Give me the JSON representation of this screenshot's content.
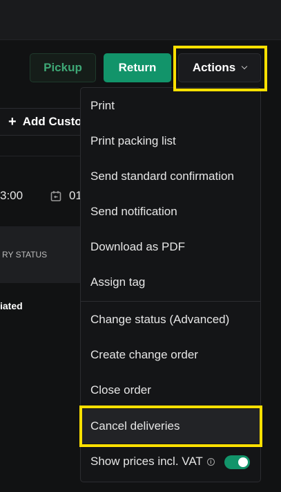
{
  "header": {
    "pickup_label": "Pickup",
    "return_label": "Return",
    "actions_label": "Actions"
  },
  "background": {
    "add_customer_label": "Add Customer",
    "time_text": "3:00",
    "date_text": "01",
    "status_header": "RY STATUS",
    "status_value": "iated"
  },
  "menu": {
    "items": [
      {
        "label": "Print"
      },
      {
        "label": "Print packing list"
      },
      {
        "label": "Send standard confirmation"
      },
      {
        "label": "Send notification"
      },
      {
        "label": "Download as PDF"
      },
      {
        "label": "Assign tag"
      },
      {
        "label": "Change status (Advanced)"
      },
      {
        "label": "Create change order"
      },
      {
        "label": "Close order"
      },
      {
        "label": "Cancel deliveries"
      }
    ],
    "vat_label": "Show prices incl. VAT",
    "vat_enabled": true
  },
  "colors": {
    "accent": "#12946a",
    "highlight": "#ffe000",
    "background": "#111213"
  },
  "icons": {
    "plus": "plus-icon",
    "calendar": "calendar-return-icon",
    "chevron": "chevron-down-icon",
    "info": "info-icon"
  }
}
